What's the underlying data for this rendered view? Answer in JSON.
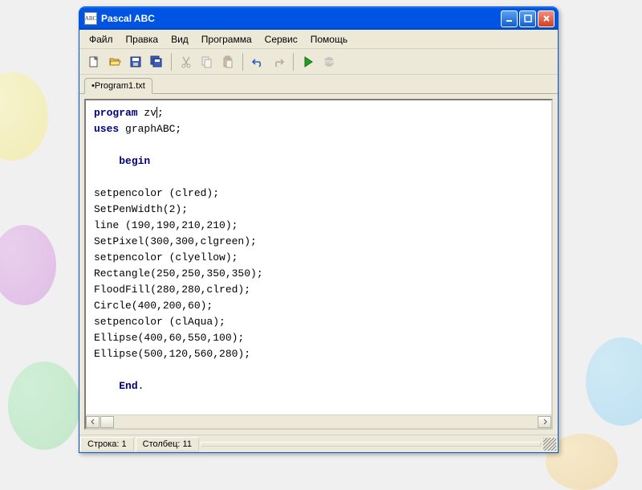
{
  "window": {
    "title": "Pascal ABC",
    "icon_text": "ABC"
  },
  "menubar": {
    "items": [
      "Файл",
      "Правка",
      "Вид",
      "Программа",
      "Сервис",
      "Помощь"
    ]
  },
  "toolbar": {
    "buttons": {
      "new": "new-file-icon",
      "open": "open-folder-icon",
      "save": "save-icon",
      "saveall": "save-all-icon",
      "cut": "cut-icon",
      "copy": "copy-icon",
      "paste": "paste-icon",
      "undo": "undo-icon",
      "redo": "redo-icon",
      "run": "run-icon",
      "stop": "stop-icon"
    }
  },
  "tabs": {
    "items": [
      {
        "modified": "•",
        "label": "Program1.txt"
      }
    ]
  },
  "code": {
    "line1_kw": "program",
    "line1_rest_a": " zv",
    "line1_rest_b": ";",
    "line2_kw": "uses",
    "line2_rest": " graphABC;",
    "line3_kw": "begin",
    "block": "\nsetpencolor (clred);\nSetPenWidth(2);\nline (190,190,210,210);\nSetPixel(300,300,clgreen);\nsetpencolor (clyellow);\nRectangle(250,250,350,350);\nFloodFill(280,280,clred);\nCircle(400,200,60);\nsetpencolor (clAqua);\nEllipse(400,60,550,100);\nEllipse(500,120,560,280);\n",
    "end_kw": "End",
    "end_dot": "."
  },
  "statusbar": {
    "row_label": "Строка:",
    "row_value": "1",
    "col_label": "Столбец:",
    "col_value": "11"
  }
}
